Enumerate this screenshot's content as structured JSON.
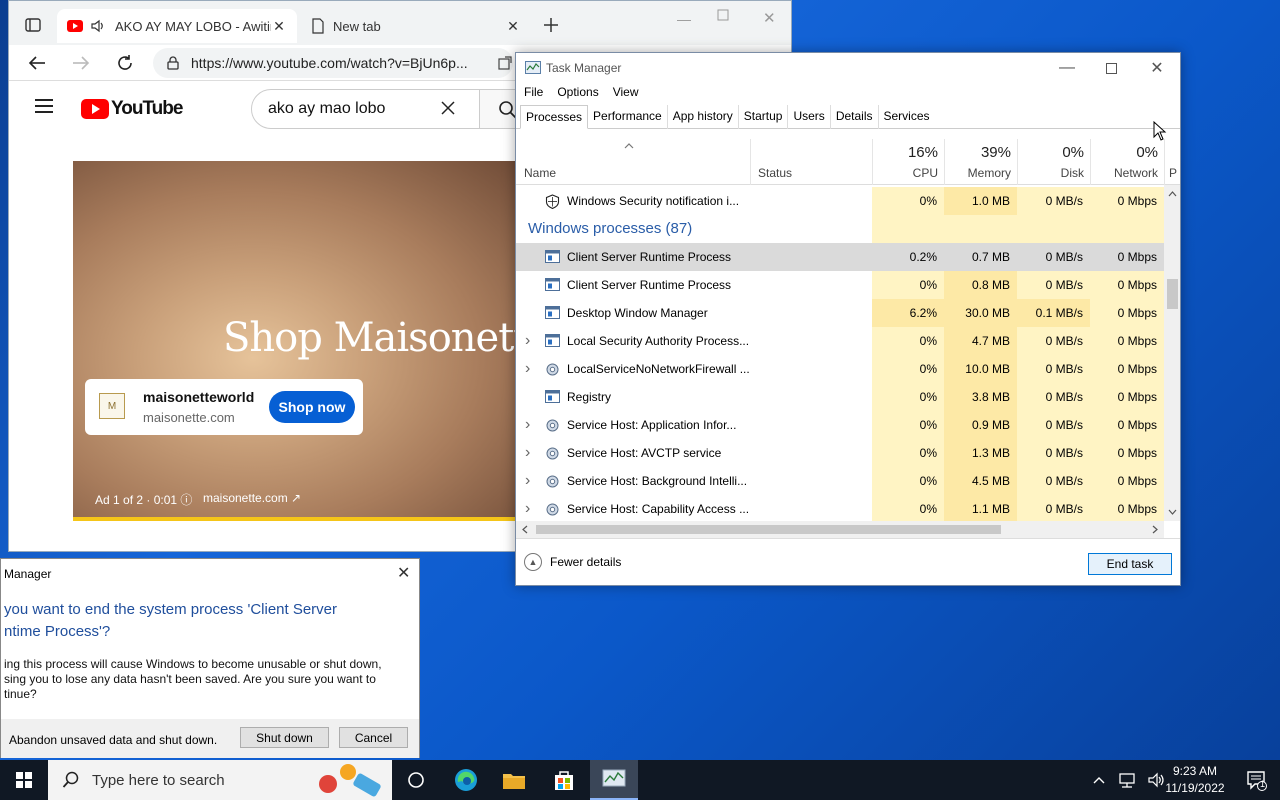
{
  "browser": {
    "tabs": [
      {
        "title": "AKO AY MAY LOBO - Awitin"
      },
      {
        "title": "New tab"
      }
    ],
    "url": "https://www.youtube.com/watch?v=BjUn6p...",
    "youtube": {
      "logo_text": "YouTube",
      "search_value": "ako ay mao lobo",
      "ad": {
        "headline": "Shop Maisonette.com",
        "advertiser": "maisonetteworld",
        "domain": "maisonette.com",
        "logo_text": "M",
        "cta": "Shop now",
        "info": "Ad 1 of 2 · 0:01 ⓘ",
        "site": "maisonette.com ↗"
      }
    }
  },
  "task_manager": {
    "title": "Task Manager",
    "menu": [
      "File",
      "Options",
      "View"
    ],
    "tabs": [
      "Processes",
      "Performance",
      "App history",
      "Startup",
      "Users",
      "Details",
      "Services"
    ],
    "active_tab": "Processes",
    "columns": {
      "name": "Name",
      "status": "Status",
      "cpu": {
        "pct": "16%",
        "label": "CPU"
      },
      "memory": {
        "pct": "39%",
        "label": "Memory"
      },
      "disk": {
        "pct": "0%",
        "label": "Disk"
      },
      "network": {
        "pct": "0%",
        "label": "Network"
      },
      "power_partial": "P"
    },
    "rows": [
      {
        "name": "Windows Security notification i...",
        "cpu": "0%",
        "mem": "1.0 MB",
        "disk": "0 MB/s",
        "net": "0 Mbps",
        "icon": "shield-icon",
        "expandable": false
      },
      {
        "group": "Windows processes (87)"
      },
      {
        "name": "Client Server Runtime Process",
        "cpu": "0.2%",
        "mem": "0.7 MB",
        "disk": "0 MB/s",
        "net": "0 Mbps",
        "icon": "window-process-icon",
        "expandable": false,
        "selected": true
      },
      {
        "name": "Client Server Runtime Process",
        "cpu": "0%",
        "mem": "0.8 MB",
        "disk": "0 MB/s",
        "net": "0 Mbps",
        "icon": "window-process-icon",
        "expandable": false
      },
      {
        "name": "Desktop Window Manager",
        "cpu": "6.2%",
        "mem": "30.0 MB",
        "disk": "0.1 MB/s",
        "net": "0 Mbps",
        "icon": "window-process-icon",
        "expandable": false
      },
      {
        "name": "Local Security Authority Process...",
        "cpu": "0%",
        "mem": "4.7 MB",
        "disk": "0 MB/s",
        "net": "0 Mbps",
        "icon": "window-process-icon",
        "expandable": true
      },
      {
        "name": "LocalServiceNoNetworkFirewall ...",
        "cpu": "0%",
        "mem": "10.0 MB",
        "disk": "0 MB/s",
        "net": "0 Mbps",
        "icon": "gear-icon",
        "expandable": true
      },
      {
        "name": "Registry",
        "cpu": "0%",
        "mem": "3.8 MB",
        "disk": "0 MB/s",
        "net": "0 Mbps",
        "icon": "window-process-icon",
        "expandable": false
      },
      {
        "name": "Service Host: Application Infor...",
        "cpu": "0%",
        "mem": "0.9 MB",
        "disk": "0 MB/s",
        "net": "0 Mbps",
        "icon": "gear-icon",
        "expandable": true
      },
      {
        "name": "Service Host: AVCTP service",
        "cpu": "0%",
        "mem": "1.3 MB",
        "disk": "0 MB/s",
        "net": "0 Mbps",
        "icon": "gear-icon",
        "expandable": true
      },
      {
        "name": "Service Host: Background Intelli...",
        "cpu": "0%",
        "mem": "4.5 MB",
        "disk": "0 MB/s",
        "net": "0 Mbps",
        "icon": "gear-icon",
        "expandable": true
      },
      {
        "name": "Service Host: Capability Access ...",
        "cpu": "0%",
        "mem": "1.1 MB",
        "disk": "0 MB/s",
        "net": "0 Mbps",
        "icon": "gear-icon",
        "expandable": true
      }
    ],
    "fewer_details": "Fewer details",
    "end_task": "End task"
  },
  "dialog": {
    "title": "Manager",
    "question_line1": "you want to end the system process 'Client Server",
    "question_line2": "ntime Process'?",
    "body_line1": "ing this process will cause Windows to become unusable or shut down,",
    "body_line2": "sing you to lose any data hasn't been saved. Are you sure you want to",
    "body_line3": "tinue?",
    "checkbox_label": "Abandon unsaved data and shut down.",
    "shutdown_button": "Shut down",
    "cancel_button": "Cancel"
  },
  "taskbar": {
    "search_placeholder": "Type here to search",
    "time": "9:23 AM",
    "date": "11/19/2022",
    "notification_count": "1"
  },
  "colors": {
    "desktop": "#1565d8",
    "youtube_red": "#ff0000",
    "accent_blue": "#0078d7",
    "heat_yellow": "#fff4c4"
  }
}
